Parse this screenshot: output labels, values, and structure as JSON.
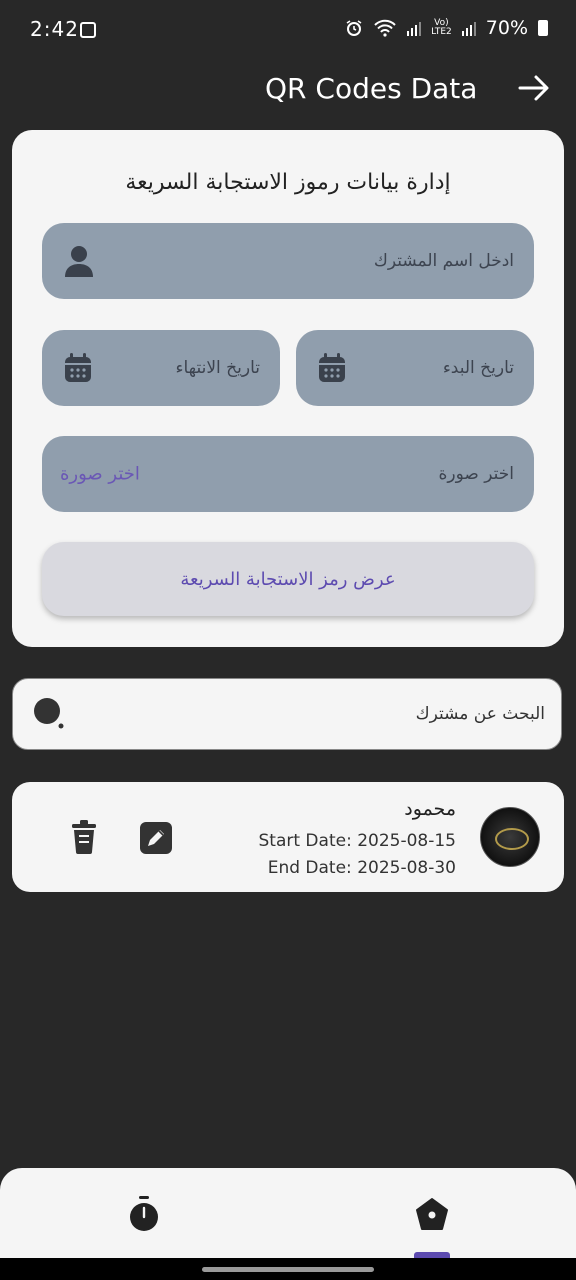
{
  "status": {
    "time": "2:42",
    "net_top": "Vo)",
    "net_bottom": "LTE2",
    "battery": "70%"
  },
  "header": {
    "title": "QR Codes Data",
    "back_icon": "arrow-right-icon"
  },
  "form": {
    "title": "إدارة بيانات رموز الاستجابة السريعة",
    "name_placeholder": "ادخل اسم المشترك",
    "start_date_placeholder": "تاريخ البدء",
    "end_date_placeholder": "تاريخ الانتهاء",
    "image_placeholder": "اختر صورة",
    "image_pick_label": "اختر صورة",
    "show_button_label": "عرض رمز الاستجابة السريعة"
  },
  "search": {
    "placeholder": "البحث عن مشترك"
  },
  "subscribers": [
    {
      "name": "محمود",
      "start_label": "Start Date: 2025-08-15",
      "end_label": "End Date: 2025-08-30"
    }
  ],
  "colors": {
    "background": "#282828",
    "card": "#f5f5f5",
    "field": "#909ead",
    "accent": "#5d4bb0"
  }
}
